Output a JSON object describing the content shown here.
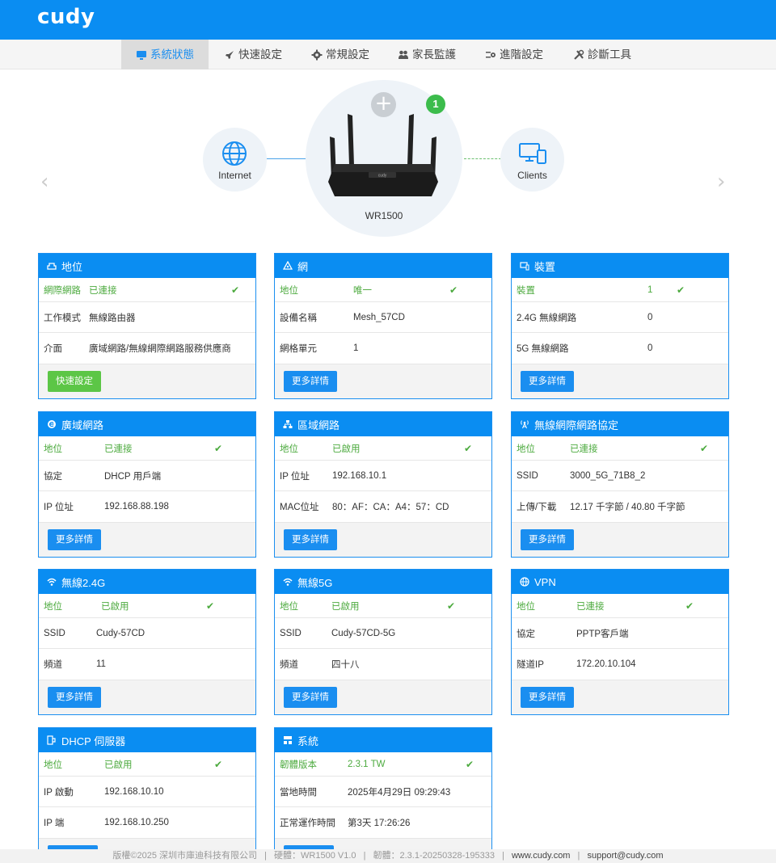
{
  "brand": {
    "logo": "cudy",
    "accent": "#0a8df2",
    "success": "#4caa3e"
  },
  "nav": [
    {
      "label": "系統狀態",
      "icon": "monitor-icon",
      "active": true
    },
    {
      "label": "快速設定",
      "icon": "rocket-icon"
    },
    {
      "label": "常規設定",
      "icon": "gear-icon"
    },
    {
      "label": "家長監護",
      "icon": "users-icon"
    },
    {
      "label": "進階設定",
      "icon": "sliders-icon"
    },
    {
      "label": "診斷工具",
      "icon": "wrench-icon"
    }
  ],
  "topology": {
    "internet_label": "Internet",
    "router_label": "WR1500",
    "router_brand": "cudy",
    "clients_label": "Clients",
    "mesh_count": "1",
    "add_symbol": "+",
    "prev_arrow": "‹",
    "next_arrow": "›"
  },
  "cards": [
    {
      "title": "地位",
      "icon": "ethernet-icon",
      "rows": [
        {
          "k": "網際網路",
          "v": "已連接",
          "status": true
        },
        {
          "k": "工作模式",
          "v": "無線路由器"
        },
        {
          "k": "介面",
          "v": "廣域網路/無線網際網路服務供應商"
        }
      ],
      "button": "快速設定"
    },
    {
      "title": "網",
      "icon": "mesh-icon",
      "rows": [
        {
          "k": "地位",
          "v": "唯一",
          "status": true
        },
        {
          "k": "設備名稱",
          "v": "Mesh_57CD"
        },
        {
          "k": "網格單元",
          "v": "1"
        }
      ],
      "button": "更多詳情"
    },
    {
      "title": "裝置",
      "icon": "devices-icon",
      "rows": [
        {
          "k": "裝置",
          "v": "1",
          "status": true
        },
        {
          "k": "2.4G 無線網路",
          "v": "0"
        },
        {
          "k": "5G 無線網路",
          "v": "0"
        }
      ],
      "button": "更多詳情"
    },
    {
      "title": "廣域網路",
      "icon": "globe-e-icon",
      "rows": [
        {
          "k": "地位",
          "v": "已連接",
          "status": true
        },
        {
          "k": "協定",
          "v": "DHCP 用戶端"
        },
        {
          "k": "IP 位址",
          "v": "192.168.88.198"
        }
      ],
      "button": "更多詳情"
    },
    {
      "title": "區域網路",
      "icon": "lan-icon",
      "rows": [
        {
          "k": "地位",
          "v": "已啟用",
          "status": true
        },
        {
          "k": "IP 位址",
          "v": "192.168.10.1"
        },
        {
          "k": "MAC位址",
          "v": "80：AF：CA：A4：57：CD"
        }
      ],
      "button": "更多詳情"
    },
    {
      "title": "無線網際網路協定",
      "icon": "antenna-icon",
      "rows": [
        {
          "k": "地位",
          "v": "已連接",
          "status": true
        },
        {
          "k": "SSID",
          "v": "3000_5G_71B8_2"
        },
        {
          "k": "上傳/下載",
          "v": "12.17 千字節 / 40.80 千字節"
        }
      ],
      "button": "更多詳情"
    },
    {
      "title": "無線2.4G",
      "icon": "wifi-icon",
      "rows": [
        {
          "k": "地位",
          "v": "已啟用",
          "status": true
        },
        {
          "k": "SSID",
          "v": "Cudy-57CD"
        },
        {
          "k": "頻道",
          "v": "11"
        }
      ],
      "button": "更多詳情"
    },
    {
      "title": "無線5G",
      "icon": "wifi-icon",
      "rows": [
        {
          "k": "地位",
          "v": "已啟用",
          "status": true
        },
        {
          "k": "SSID",
          "v": "Cudy-57CD-5G"
        },
        {
          "k": "頻道",
          "v": "四十八"
        }
      ],
      "button": "更多詳情"
    },
    {
      "title": "VPN",
      "icon": "vpn-globe-icon",
      "rows": [
        {
          "k": "地位",
          "v": "已連接",
          "status": true
        },
        {
          "k": "協定",
          "v": "PPTP客戶端"
        },
        {
          "k": "隧道IP",
          "v": "172.20.10.104"
        }
      ],
      "button": "更多詳情"
    },
    {
      "title": "DHCP 伺服器",
      "icon": "dhcp-icon",
      "rows": [
        {
          "k": "地位",
          "v": "已啟用",
          "status": true
        },
        {
          "k": "IP 啟動",
          "v": "192.168.10.10"
        },
        {
          "k": "IP 端",
          "v": "192.168.10.250"
        }
      ],
      "button": ""
    },
    {
      "title": "系統",
      "icon": "system-icon",
      "rows": [
        {
          "k": "韌體版本",
          "v": "2.3.1 TW",
          "status": true
        },
        {
          "k": "當地時間",
          "v": "2025年4月29日 09:29:43"
        },
        {
          "k": "正常運作時間",
          "v": "第3天 17:26:26"
        }
      ],
      "button": ""
    }
  ],
  "footer": {
    "copyright": "版權©2025 深圳市庫迪科技有限公司",
    "hardware": "硬體：WR1500 V1.0",
    "firmware": "韌體：2.3.1-20250328-195333",
    "website": "www.cudy.com",
    "email": "support@cudy.com",
    "sep": "|"
  }
}
